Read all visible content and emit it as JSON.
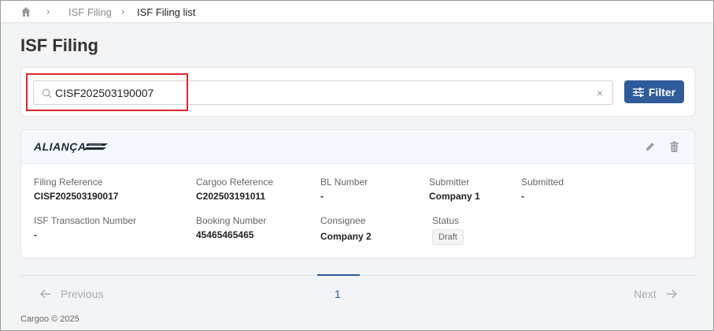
{
  "breadcrumb": {
    "items": [
      "ISF Filing",
      "ISF Filing list"
    ]
  },
  "page": {
    "title": "ISF Filing"
  },
  "search": {
    "value": "CISF202503190007",
    "clear_symbol": "×"
  },
  "filter_button": {
    "label": "Filter"
  },
  "result": {
    "carrier_logo": "ALIANÇA",
    "fields": {
      "filing_reference": {
        "label": "Filing Reference",
        "value": "CISF202503190017"
      },
      "cargoo_reference": {
        "label": "Cargoo Reference",
        "value": "C202503191011"
      },
      "bl_number": {
        "label": "BL Number",
        "value": "-"
      },
      "submitter": {
        "label": "Submitter",
        "value": "Company 1"
      },
      "submitted": {
        "label": "Submitted",
        "value": "-"
      },
      "isf_transaction_number": {
        "label": "ISF Transaction Number",
        "value": "-"
      },
      "booking_number": {
        "label": "Booking Number",
        "value": "45465465465"
      },
      "consignee": {
        "label": "Consignee",
        "value": "Company 2"
      },
      "status": {
        "label": "Status",
        "value": "Draft"
      }
    }
  },
  "pagination": {
    "previous": "Previous",
    "next": "Next",
    "current_page": "1"
  },
  "footer": {
    "text": "Cargoo © 2025"
  },
  "colors": {
    "accent": "#2f5b9a",
    "highlight": "#e0262c"
  },
  "icons": [
    "home-icon",
    "chevron-right-icon",
    "search-icon",
    "clear-icon",
    "sliders-icon",
    "edit-icon",
    "trash-icon",
    "arrow-left-icon",
    "arrow-right-icon"
  ]
}
